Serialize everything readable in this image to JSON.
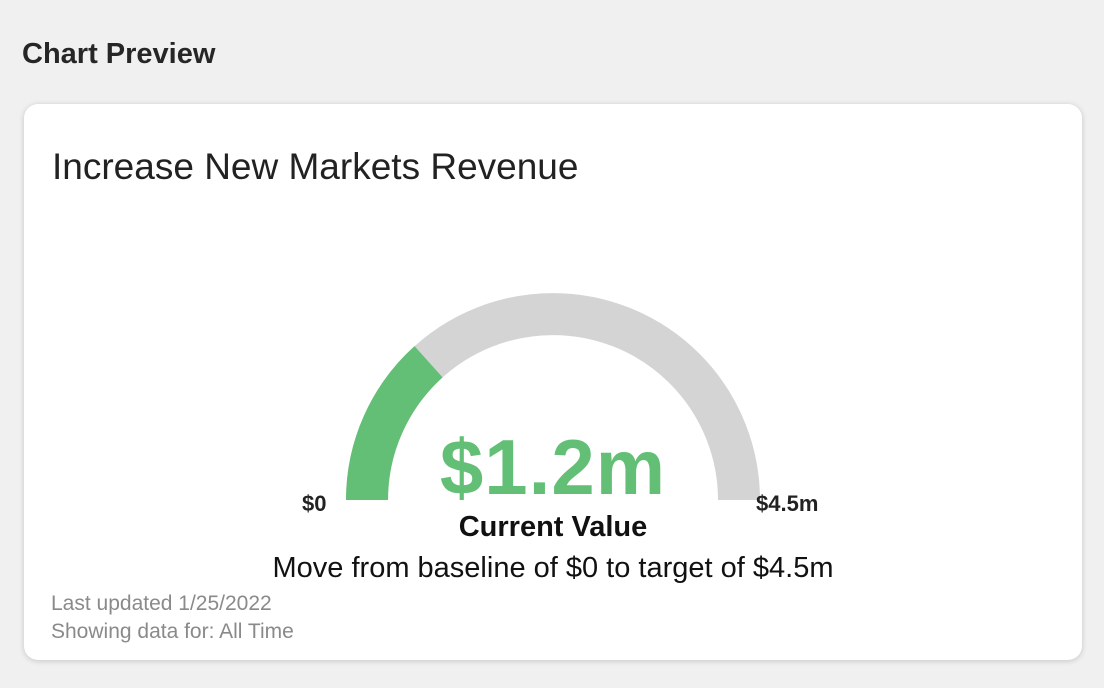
{
  "header": {
    "title": "Chart Preview"
  },
  "card": {
    "title": "Increase New Markets Revenue",
    "current_value_display": "$1.2m",
    "current_value_caption": "Current Value",
    "min_label": "$0",
    "max_label": "$4.5m",
    "description": "Move from baseline of $0 to target of $4.5m",
    "last_updated": "Last updated 1/25/2022",
    "showing_data_for": "Showing data for: All Time"
  },
  "chart_data": {
    "type": "gauge",
    "title": "Increase New Markets Revenue",
    "min": 0,
    "max": 4.5,
    "value": 1.2,
    "units": "$m",
    "min_label": "$0",
    "max_label": "$4.5m",
    "value_label": "$1.2m",
    "colors": {
      "fill": "#63bf75",
      "track": "#d4d4d4"
    }
  }
}
